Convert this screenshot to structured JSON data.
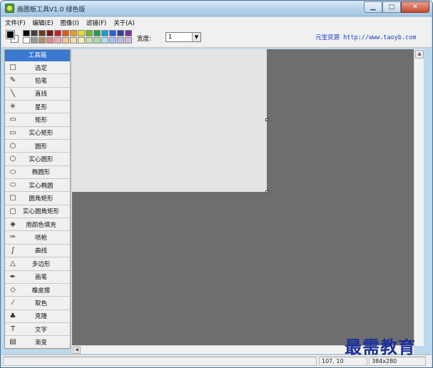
{
  "window": {
    "title": "画图板工具V1.0 绿色版"
  },
  "menu": [
    "文件(F)",
    "编辑(E)",
    "图像(I)",
    "滤镜(F)",
    "关于(A)"
  ],
  "palette": {
    "row1": [
      "#000000",
      "#404040",
      "#6e3a1e",
      "#7a1818",
      "#c81e1e",
      "#e05a1a",
      "#e8a018",
      "#e8dc28",
      "#78b428",
      "#1ea048",
      "#18a0c8",
      "#2860d8",
      "#384090",
      "#6e3896"
    ],
    "row2": [
      "#ffffff",
      "#9a9a9a",
      "#b48c6a",
      "#d88c8c",
      "#f0a8b8",
      "#f0c890",
      "#f4e0a0",
      "#f4f0b8",
      "#c8e0a0",
      "#a8dcb0",
      "#a8e0ec",
      "#a8c0ec",
      "#b8b8e0",
      "#d0b8e0"
    ]
  },
  "width_label": "宽度:",
  "width_value": "1",
  "site_link": "元宝资源 http://www.taoyb.com",
  "toolbox": {
    "header": "工具箱",
    "tools": [
      {
        "icon": "□",
        "label": "选定"
      },
      {
        "icon": "✎",
        "label": "铅笔"
      },
      {
        "icon": "╲",
        "label": "直线"
      },
      {
        "icon": "✳",
        "label": "星形"
      },
      {
        "icon": "▭",
        "label": "矩形"
      },
      {
        "icon": "▭",
        "label": "实心矩形"
      },
      {
        "icon": "○",
        "label": "圆形"
      },
      {
        "icon": "○",
        "label": "实心圆形"
      },
      {
        "icon": "⬭",
        "label": "椭圆形"
      },
      {
        "icon": "⬭",
        "label": "实心椭圆"
      },
      {
        "icon": "▢",
        "label": "圆角矩形"
      },
      {
        "icon": "▢",
        "label": "实心圆角矩形"
      },
      {
        "icon": "◈",
        "label": "用颜色填充"
      },
      {
        "icon": "✑",
        "label": "喷枪"
      },
      {
        "icon": "∫",
        "label": "曲线"
      },
      {
        "icon": "△",
        "label": "多边形"
      },
      {
        "icon": "✒",
        "label": "画笔"
      },
      {
        "icon": "◇",
        "label": "橡皮擦"
      },
      {
        "icon": "⁄",
        "label": "取色"
      },
      {
        "icon": "♣",
        "label": "克隆"
      },
      {
        "icon": "T",
        "label": "文字"
      },
      {
        "icon": "▤",
        "label": "渐变"
      }
    ]
  },
  "status": {
    "message": "",
    "coords": "107, 10",
    "size": "384x280"
  },
  "watermark": "最需教育"
}
